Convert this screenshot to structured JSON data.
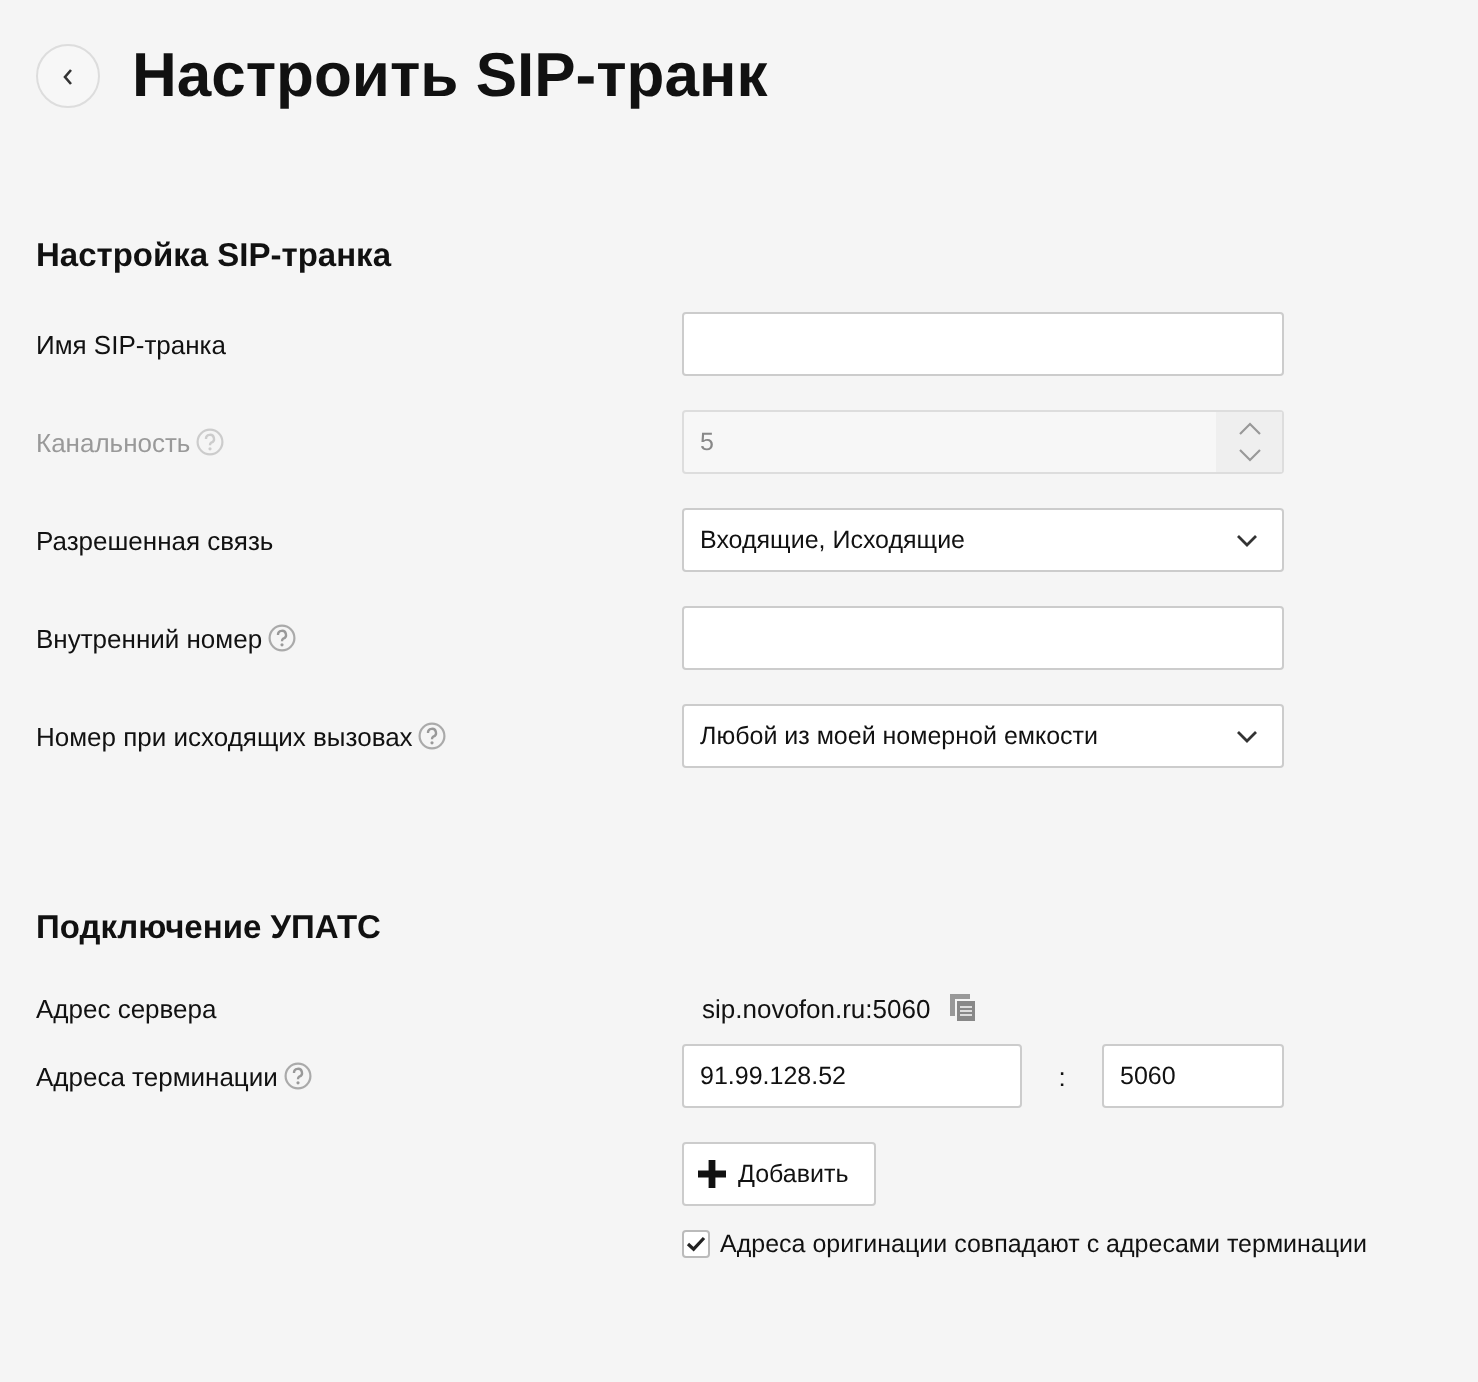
{
  "header": {
    "title": "Настроить SIP-транк"
  },
  "trunk": {
    "title": "Настройка SIP-транка",
    "fields": [
      {
        "kind": "text",
        "label": "Имя SIP-транка",
        "help": false,
        "disabled": false
      },
      {
        "kind": "number",
        "label": "Канальность",
        "help": true,
        "disabled": true,
        "value": "5"
      },
      {
        "kind": "select",
        "label": "Разрешенная связь",
        "help": false,
        "disabled": false,
        "value": "Входящие, Исходящие"
      },
      {
        "kind": "text",
        "label": "Внутренний номер",
        "help": true,
        "disabled": false
      },
      {
        "kind": "select",
        "label": "Номер при исходящих вызовах",
        "help": true,
        "disabled": false,
        "value": "Любой из моей номерной емкости"
      }
    ]
  },
  "pbx": {
    "title": "Подключение УПАТС",
    "fields": [
      {
        "kind": "static",
        "label": "Адрес сервера",
        "help": false,
        "value": "sip.novofon.ru:5060"
      },
      {
        "kind": "address",
        "label": "Адреса терминации",
        "help": true,
        "host": "91.99.128.52",
        "separator": ":",
        "port": "5060"
      }
    ],
    "add_button": "Добавить",
    "same_origination": {
      "label": "Адреса оригинации совпадают с адресами терминации",
      "checked": true
    }
  }
}
